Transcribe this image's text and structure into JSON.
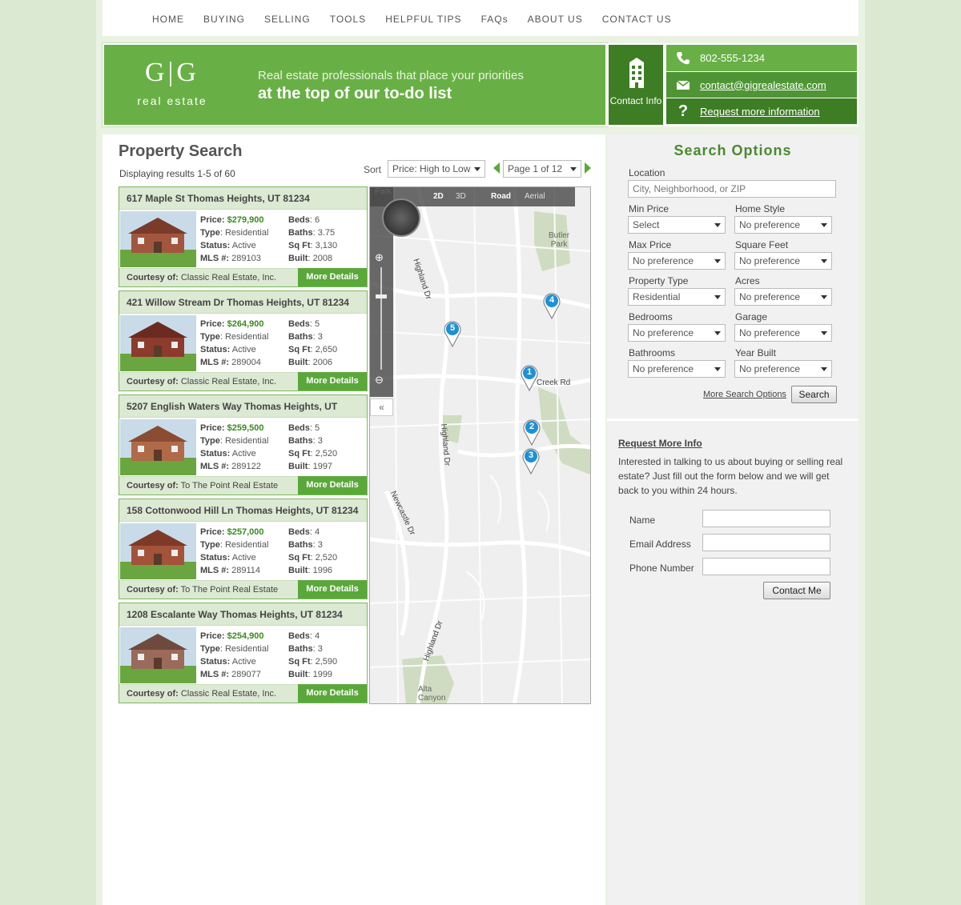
{
  "nav": [
    "HOME",
    "BUYING",
    "SELLING",
    "TOOLS",
    "HELPFUL TIPS",
    "FAQs",
    "ABOUT US",
    "CONTACT US"
  ],
  "hero": {
    "logo_mark": "G|G",
    "logo_text": "real estate",
    "tagline_1": "Real estate professionals that place your priorities",
    "tagline_2": "at the top of our to-do list",
    "contact_box": "Contact Info",
    "phone": "802-555-1234",
    "email": "contact@gigrealestate.com",
    "request": "Request more information"
  },
  "search": {
    "title": "Property Search",
    "count": "Displaying results 1-5 of 60",
    "sort_label": "Sort",
    "sort_value": "Price: High to Low",
    "page_value": "Page 1 of 12"
  },
  "listings": [
    {
      "address": "617 Maple St  Thomas Heights, UT 81234",
      "price": "$279,900",
      "type": "Residential",
      "status": "Active",
      "mls": "289103",
      "beds": "6",
      "baths": "3.75",
      "sqft": "3,130",
      "built": "2008",
      "courtesy": "Classic Real Estate, Inc."
    },
    {
      "address": "421 Willow Stream Dr  Thomas Heights, UT 81234",
      "price": "$264,900",
      "type": "Residential",
      "status": "Active",
      "mls": "289004",
      "beds": "5",
      "baths": "3",
      "sqft": "2,650",
      "built": "2006",
      "courtesy": "Classic Real Estate, Inc."
    },
    {
      "address": "5207 English Waters Way  Thomas Heights, UT",
      "price": "$259,500",
      "type": "Residential",
      "status": "Active",
      "mls": "289122",
      "beds": "5",
      "baths": "3",
      "sqft": "2,520",
      "built": "1997",
      "courtesy": "To The Point Real Estate"
    },
    {
      "address": "158 Cottonwood Hill Ln  Thomas Heights, UT 81234",
      "price": "$257,000",
      "type": "Residential",
      "status": "Active",
      "mls": "289114",
      "beds": "4",
      "baths": "3",
      "sqft": "2,520",
      "built": "1996",
      "courtesy": "To The Point Real Estate"
    },
    {
      "address": "1208 Escalante Way  Thomas Heights, UT 81234",
      "price": "$254,900",
      "type": "Residential",
      "status": "Active",
      "mls": "289077",
      "beds": "4",
      "baths": "3",
      "sqft": "2,590",
      "built": "1999",
      "courtesy": "Classic Real Estate, Inc."
    }
  ],
  "labels": {
    "price": "Price:",
    "type": "Type",
    "status": "Status:",
    "mls": "MLS #:",
    "beds": "Beds",
    "baths": "Baths",
    "sqft": "Sq Ft",
    "built": "Built",
    "courtesy": "Courtesy of:",
    "more": "More Details"
  },
  "map": {
    "mode_2d": "2D",
    "mode_3d": "3D",
    "road": "Road",
    "aerial": "Aerial",
    "streets": [
      "Highland Dr",
      "Highland Dr",
      "Newcastle Dr",
      "Highland Dr",
      "Creek Rd"
    ],
    "places": [
      "Butler Park",
      "Alta Canyon",
      "Park"
    ],
    "markers": [
      "1",
      "2",
      "3",
      "4",
      "5"
    ]
  },
  "options": {
    "title": "Search Options",
    "location_label": "Location",
    "location_placeholder": "City, Neighborhood, or ZIP",
    "min_price_label": "Min Price",
    "min_price": "Select",
    "home_style_label": "Home Style",
    "home_style": "No preference",
    "max_price_label": "Max Price",
    "max_price": "No preference",
    "sqft_label": "Square Feet",
    "sqft": "No preference",
    "prop_type_label": "Property Type",
    "prop_type": "Residential",
    "acres_label": "Acres",
    "acres": "No preference",
    "bedrooms_label": "Bedrooms",
    "bedrooms": "No preference",
    "garage_label": "Garage",
    "garage": "No preference",
    "bathrooms_label": "Bathrooms",
    "bathrooms": "No preference",
    "year_label": "Year Built",
    "year": "No preference",
    "more_options": "More Search Options",
    "search_button": "Search"
  },
  "request_info": {
    "title": "Request More Info",
    "text": "Interested in talking to us about buying or selling real estate? Just fill out the form below and we will get back to you within 24 hours.",
    "name_label": "Name",
    "email_label": "Email Address",
    "phone_label": "Phone Number",
    "button": "Contact Me"
  },
  "colors": {
    "brand_green": "#68b045",
    "dark_green": "#3d7d24",
    "price_green": "#3a8a1e",
    "marker_blue": "#1e90d6"
  }
}
